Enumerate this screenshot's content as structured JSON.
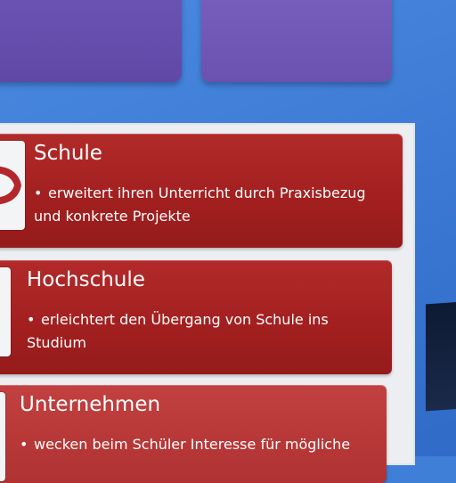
{
  "cards": [
    {
      "title": "Schule",
      "bullet": "erweitert ihren Unterricht durch Praxisbezug und konkrete Projekte"
    },
    {
      "title": "Hochschule",
      "bullet": "erleichtert den Übergang von Schule ins Studium"
    },
    {
      "title": "Unternehmen",
      "bullet": "wecken beim Schüler Interesse für mögliche"
    }
  ],
  "colors": {
    "background": "#3f7fd8",
    "card": "#a21f1f",
    "tile": "#5f48a6",
    "panel": "#eceef2"
  },
  "icons": [
    "cycle-arrows-icon"
  ]
}
